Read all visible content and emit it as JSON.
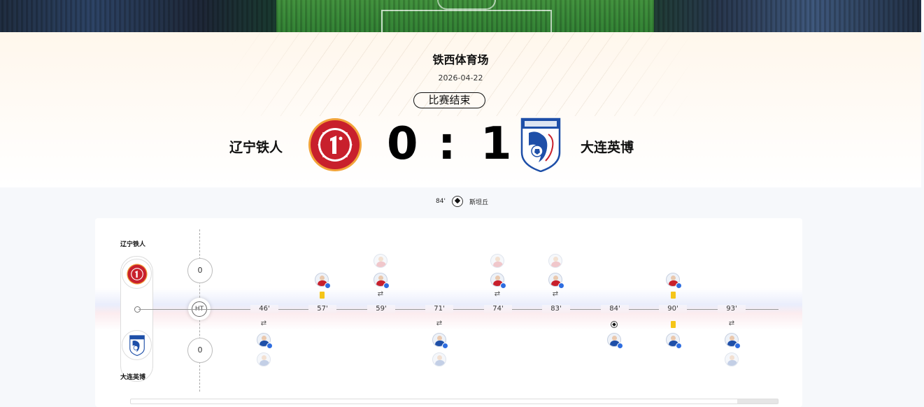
{
  "match": {
    "venue": "铁西体育场",
    "date": "2026-04-22",
    "status": "比赛结束",
    "home": {
      "name": "辽宁铁人",
      "score": "0",
      "logo_icon": "liaoning-tieren-crest-icon",
      "color": "#c8202c"
    },
    "away": {
      "name": "大连英博",
      "score": "1",
      "logo_icon": "dalian-yingbo-crest-icon",
      "color": "#1e4fa8"
    },
    "score_separator": ":"
  },
  "goal_summary": {
    "minute": "84'",
    "scorer": "斯坦丘"
  },
  "timeline": {
    "home_label": "辽宁铁人",
    "away_label": "大连英博",
    "half_time_label": "HT",
    "home_half_score": "0",
    "away_half_score": "0",
    "minutes": [
      "46'",
      "57'",
      "59'",
      "71'",
      "74'",
      "83'",
      "84'",
      "90'",
      "93'"
    ]
  }
}
